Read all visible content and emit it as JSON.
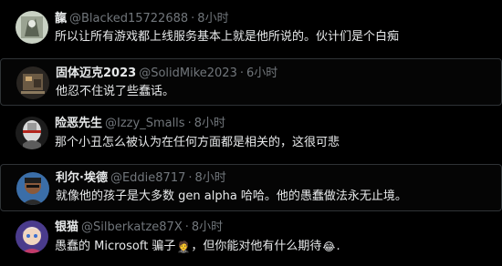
{
  "replies": [
    {
      "name": "靝",
      "handle": "@Blacked15722688",
      "time": "8小时",
      "text": "所以让所有游戏都上线服务基本上就是他所说的。伙计们是个白痴"
    },
    {
      "name": "固体迈克2023",
      "handle": "@SolidMike2023",
      "time": "6小时",
      "text": "他忍不住说了些蠢话。"
    },
    {
      "name": "险恶先生",
      "handle": "@Izzy_Smalls",
      "time": "8小时",
      "text": "那个小丑怎么被认为在任何方面都是相关的，这很可悲"
    },
    {
      "name": "利尔·埃德",
      "handle": "@Eddie8717",
      "time": "8小时",
      "text": "就像他的孩子是大多数 gen alpha 哈哈。他的愚蠢做法永无止境。"
    },
    {
      "name": "银猫",
      "handle": "@Silberkatze87X",
      "time": "8小时",
      "text_before": "愚蠢的 Microsoft 骗子",
      "emoji_1": "🤵",
      "text_middle": "，但你能对他有什么期待",
      "emoji_2": "😂",
      "text_after": "."
    }
  ],
  "separator": "·",
  "colors": {
    "background": "#000000",
    "text": "#e7e9ea",
    "secondary": "#71767b",
    "border": "#2f3336"
  }
}
